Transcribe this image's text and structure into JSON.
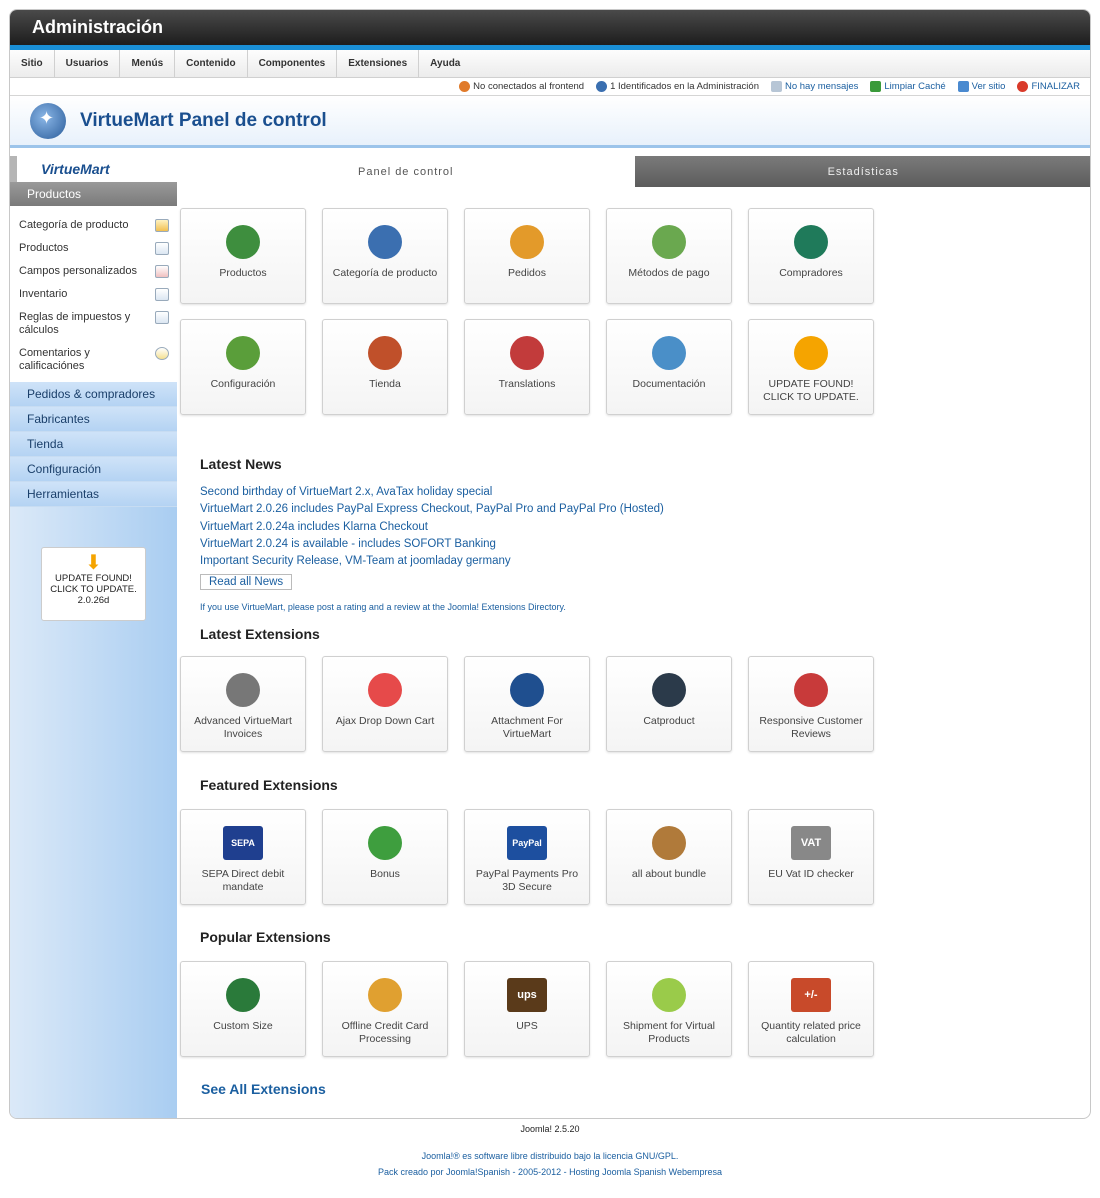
{
  "header": {
    "title": "Administración"
  },
  "menu": [
    "Sitio",
    "Usuarios",
    "Menús",
    "Contenido",
    "Componentes",
    "Extensiones",
    "Ayuda"
  ],
  "status": {
    "frontend": "No conectados al frontend",
    "admins": "1 Identificados en la Administración",
    "messages": "No hay mensajes",
    "cache": "Limpiar Caché",
    "site": "Ver sitio",
    "logout": "FINALIZAR"
  },
  "page": {
    "title": "VirtueMart Panel de control"
  },
  "sidebar": {
    "logo": "VirtueMart",
    "section": "Productos",
    "items": [
      {
        "label": "Categoría de producto",
        "icon": "folder-icon"
      },
      {
        "label": "Productos",
        "icon": "product-icon"
      },
      {
        "label": "Campos personalizados",
        "icon": "custom-fields-icon"
      },
      {
        "label": "Inventario",
        "icon": "inventory-icon"
      },
      {
        "label": "Reglas de impuestos y cálculos",
        "icon": "calculator-icon"
      },
      {
        "label": "Comentarios y calificaciónes",
        "icon": "comments-icon"
      }
    ],
    "sections": [
      "Pedidos & compradores",
      "Fabricantes",
      "Tienda",
      "Configuración",
      "Herramientas"
    ],
    "update": {
      "line1": "UPDATE FOUND!",
      "line2": "CLICK TO UPDATE.",
      "version": "2.0.26d"
    }
  },
  "tabs": [
    "Panel de control",
    "Estadísticas"
  ],
  "dashboard": [
    {
      "label": "Productos",
      "icon": "barcode-icon",
      "color": "#3e8e3e"
    },
    {
      "label": "Categoría de producto",
      "icon": "category-icon",
      "color": "#3b6fb0"
    },
    {
      "label": "Pedidos",
      "icon": "orders-icon",
      "color": "#e39a2a"
    },
    {
      "label": "Métodos de pago",
      "icon": "payment-icon",
      "color": "#6aa84f"
    },
    {
      "label": "Compradores",
      "icon": "shoppers-icon",
      "color": "#1f7a5a"
    },
    {
      "label": "Configuración",
      "icon": "wrench-icon",
      "color": "#5a9e3a"
    },
    {
      "label": "Tienda",
      "icon": "store-icon",
      "color": "#c0502a"
    },
    {
      "label": "Translations",
      "icon": "translations-icon",
      "color": "#c23b3b"
    },
    {
      "label": "Documentación",
      "icon": "magnifier-icon",
      "color": "#4a8fc8"
    },
    {
      "label": "UPDATE FOUND! CLICK TO UPDATE.",
      "icon": "update-arrow-icon",
      "color": "#f5a400"
    }
  ],
  "news": {
    "title": "Latest News",
    "items": [
      "Second birthday of VirtueMart 2.x, AvaTax holiday special",
      "VirtueMart 2.0.26 includes PayPal Express Checkout, PayPal Pro and PayPal Pro (Hosted)",
      "VirtueMart 2.0.24a includes Klarna Checkout",
      "VirtueMart 2.0.24 is available - includes SOFORT Banking",
      "Important Security Release, VM-Team at joomladay germany"
    ],
    "read_all": "Read all News",
    "rate": "If you use VirtueMart, please post a rating and a review at the Joomla! Extensions Directory."
  },
  "latest_ext": {
    "title": "Latest Extensions",
    "items": [
      {
        "label": "Advanced VirtueMart Invoices",
        "icon": "invoice-icon",
        "color": "#777777"
      },
      {
        "label": "Ajax Drop Down Cart",
        "icon": "cart-wheel-icon",
        "color": "#e64a4a"
      },
      {
        "label": "Attachment For VirtueMart",
        "icon": "attachment-box-icon",
        "color": "#1f4f8f"
      },
      {
        "label": "Catproduct",
        "icon": "catproduct-icon",
        "color": "#2b3a4a"
      },
      {
        "label": "Responsive Customer Reviews",
        "icon": "award-icon",
        "color": "#c83a3a"
      }
    ]
  },
  "featured_ext": {
    "title": "Featured Extensions",
    "items": [
      {
        "label": "SEPA Direct debit mandate",
        "icon": "sepa-icon",
        "color": "#1f3f8f",
        "glyph": "SEPA"
      },
      {
        "label": "Bonus",
        "icon": "gift-icon",
        "color": "#3e9e3e"
      },
      {
        "label": "PayPal Payments Pro 3D Secure",
        "icon": "paypal-icon",
        "color": "#1d4f9f",
        "glyph": "PayPal"
      },
      {
        "label": "all about bundle",
        "icon": "bundle-box-icon",
        "color": "#b07a3a"
      },
      {
        "label": "EU Vat ID checker",
        "icon": "vat-icon",
        "color": "#888888",
        "glyph": "VAT"
      }
    ]
  },
  "popular_ext": {
    "title": "Popular Extensions",
    "items": [
      {
        "label": "Custom Size",
        "icon": "custom-size-icon",
        "color": "#2a7a3a"
      },
      {
        "label": "Offline Credit Card Processing",
        "icon": "credit-card-icon",
        "color": "#e0a030"
      },
      {
        "label": "UPS",
        "icon": "ups-icon",
        "color": "#5a3a1a",
        "glyph": "ups"
      },
      {
        "label": "Shipment for Virtual Products",
        "icon": "shipment-icon",
        "color": "#9acb4a"
      },
      {
        "label": "Quantity related price calculation",
        "icon": "price-calc-icon",
        "color": "#c84a2a",
        "glyph": "+/-"
      }
    ]
  },
  "see_all": "See All Extensions",
  "footer": {
    "version": "Joomla! 2.5.20",
    "license": "Joomla!® es software libre distribuido bajo la licencia GNU/GPL.",
    "credits": "Pack creado por Joomla!Spanish - 2005-2012 - Hosting Joomla Spanish Webempresa"
  }
}
